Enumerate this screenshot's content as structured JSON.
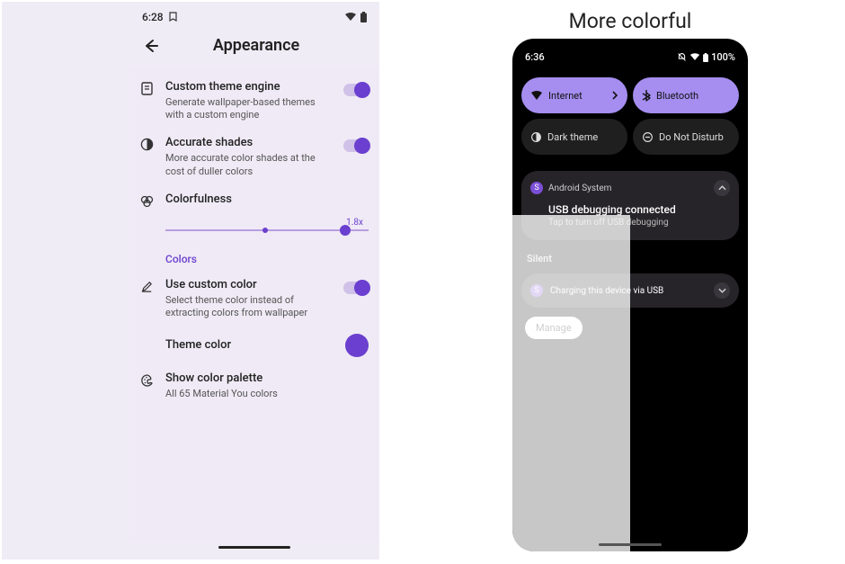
{
  "left": {
    "status": {
      "time": "6:28",
      "right_icons": [
        "wifi-icon",
        "battery-icon"
      ]
    },
    "header": {
      "title": "Appearance"
    },
    "settings": [
      {
        "icon": "theme-engine-icon",
        "title": "Custom theme engine",
        "sub": "Generate wallpaper-based themes with a custom engine",
        "toggle": true
      },
      {
        "icon": "contrast-icon",
        "title": "Accurate shades",
        "sub": "More accurate color shades at the cost of duller colors",
        "toggle": true
      },
      {
        "icon": "colorfulness-icon",
        "title": "Colorfulness",
        "slider": true
      }
    ],
    "slider": {
      "value": "1.8x"
    },
    "section_label": "Colors",
    "colors_settings": [
      {
        "icon": "pencil-icon",
        "title": "Use custom color",
        "sub": "Select theme color instead of extracting colors from wallpaper",
        "toggle": true
      },
      {
        "icon": "",
        "title": "Theme color",
        "colordot": true
      },
      {
        "icon": "palette-icon",
        "title": "Show color palette",
        "sub": "All 65 Material You colors"
      }
    ]
  },
  "right": {
    "title": "More colorful",
    "status": {
      "time": "6:36",
      "battery": "100%"
    },
    "tiles": [
      {
        "icon": "wifi-icon",
        "label": "Internet",
        "active": true,
        "chevron": true
      },
      {
        "icon": "bluetooth-icon",
        "label": "Bluetooth",
        "active": true
      },
      {
        "icon": "dark-icon",
        "label": "Dark theme",
        "active": false
      },
      {
        "icon": "dnd-icon",
        "label": "Do Not Disturb",
        "active": false
      }
    ],
    "notif": {
      "app": "Android System",
      "title": "USB debugging connected",
      "sub": "Tap to turn off USB debugging"
    },
    "silent_label": "Silent",
    "notif_collapsed": {
      "text": "Charging this device via USB"
    },
    "manage": "Manage"
  },
  "colors": {
    "accent": "#6b3fcf"
  }
}
